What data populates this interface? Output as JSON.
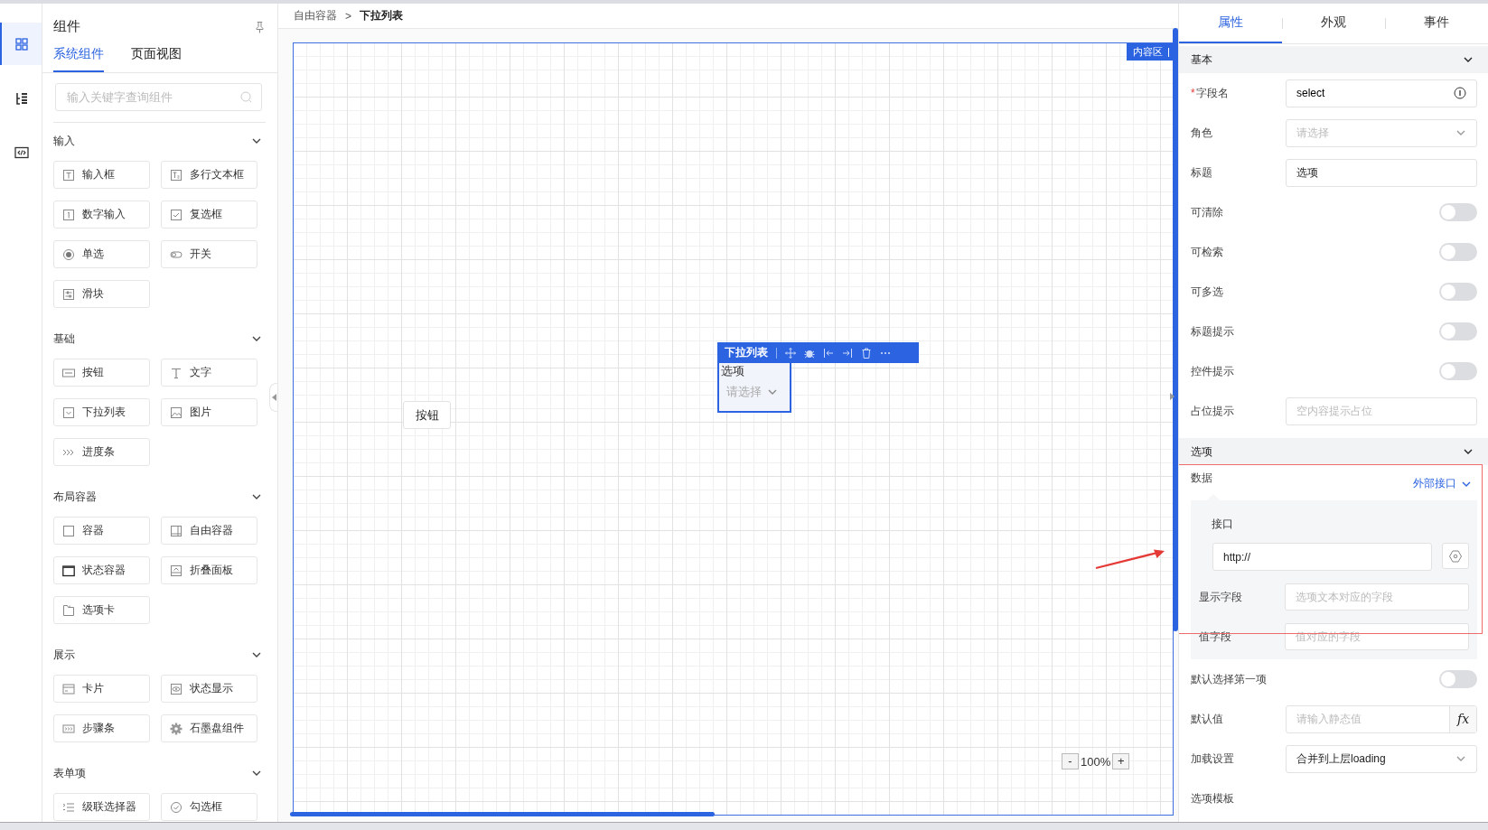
{
  "rail": [
    {
      "kind": "grid",
      "selected": true
    },
    {
      "kind": "tree",
      "selected": false
    },
    {
      "kind": "code",
      "selected": false
    }
  ],
  "left_panel": {
    "title": "组件",
    "tabs": [
      {
        "label": "系统组件",
        "selected": true
      },
      {
        "label": "页面视图",
        "selected": false
      }
    ],
    "search": {
      "placeholder": "输入关键字查询组件"
    },
    "groups": [
      {
        "title": "输入",
        "expanded": true,
        "items": [
          {
            "label": "输入框",
            "kind": "text-input"
          },
          {
            "label": "多行文本框",
            "kind": "textarea"
          },
          {
            "label": "数字输入",
            "kind": "number"
          },
          {
            "label": "复选框",
            "kind": "checkbox"
          },
          {
            "label": "单选",
            "kind": "radio"
          },
          {
            "label": "开关",
            "kind": "switch"
          },
          {
            "label": "滑块",
            "kind": "slider"
          }
        ]
      },
      {
        "title": "基础",
        "expanded": true,
        "items": [
          {
            "label": "按钮",
            "kind": "button"
          },
          {
            "label": "文字",
            "kind": "text"
          },
          {
            "label": "下拉列表",
            "kind": "select"
          },
          {
            "label": "图片",
            "kind": "image"
          },
          {
            "label": "进度条",
            "kind": "progress"
          }
        ]
      },
      {
        "title": "布局容器",
        "expanded": true,
        "items": [
          {
            "label": "容器",
            "kind": "container"
          },
          {
            "label": "自由容器",
            "kind": "free-container"
          },
          {
            "label": "状态容器",
            "kind": "state-container"
          },
          {
            "label": "折叠面板",
            "kind": "collapse"
          },
          {
            "label": "选项卡",
            "kind": "tabs"
          }
        ]
      },
      {
        "title": "展示",
        "expanded": true,
        "items": [
          {
            "label": "卡片",
            "kind": "card"
          },
          {
            "label": "状态显示",
            "kind": "status"
          },
          {
            "label": "步骤条",
            "kind": "steps"
          },
          {
            "label": "石墨盘组件",
            "kind": "gear"
          }
        ]
      },
      {
        "title": "表单项",
        "expanded": true,
        "items": [
          {
            "label": "级联选择器",
            "kind": "cascader"
          },
          {
            "label": "勾选框",
            "kind": "check-circle"
          }
        ]
      }
    ]
  },
  "breadcrumb": {
    "items": [
      "自由容器",
      "下拉列表"
    ],
    "separator": ">"
  },
  "canvas": {
    "region_label": "内容区",
    "button": {
      "label": "按钮"
    },
    "selected_widget": {
      "name": "下拉列表",
      "label": "选项",
      "placeholder": "请选择"
    },
    "zoom": {
      "minus": "-",
      "value": "100%",
      "plus": "+"
    }
  },
  "properties": {
    "tabs": [
      {
        "label": "属性",
        "selected": true
      },
      {
        "label": "外观",
        "selected": false
      },
      {
        "label": "事件",
        "selected": false
      }
    ],
    "sections": [
      {
        "title": "基本",
        "expanded": true,
        "rows": [
          {
            "kind": "text",
            "label": "字段名",
            "required_mark": "*",
            "value": "select"
          },
          {
            "kind": "select",
            "label": "角色",
            "placeholder": "请选择"
          },
          {
            "kind": "text",
            "label": "标题",
            "value": "选项"
          },
          {
            "kind": "switch",
            "label": "可清除",
            "on": false
          },
          {
            "kind": "switch",
            "label": "可检索",
            "on": false
          },
          {
            "kind": "switch",
            "label": "可多选",
            "on": false
          },
          {
            "kind": "switch",
            "label": "标题提示",
            "on": false
          },
          {
            "kind": "switch",
            "label": "控件提示",
            "on": false
          },
          {
            "kind": "input",
            "label": "占位提示",
            "placeholder": "空内容提示占位"
          }
        ]
      },
      {
        "title": "选项",
        "expanded": true,
        "rows": [
          {
            "kind": "data_source",
            "label": "数据",
            "source": "外部接口",
            "api_label": "接口",
            "api_value": "http://",
            "fields": [
              {
                "label": "显示字段",
                "placeholder": "选项文本对应的字段"
              },
              {
                "label": "值字段",
                "placeholder": "值对应的字段"
              }
            ]
          },
          {
            "kind": "switch",
            "label": "默认选择第一项",
            "on": false
          },
          {
            "kind": "expression",
            "label": "默认值",
            "placeholder": "请输入静态值",
            "fx_label": "fx"
          },
          {
            "kind": "select",
            "label": "加载设置",
            "value": "合并到上层loading"
          },
          {
            "kind": "label_only",
            "label": "选项模板"
          }
        ]
      }
    ]
  }
}
